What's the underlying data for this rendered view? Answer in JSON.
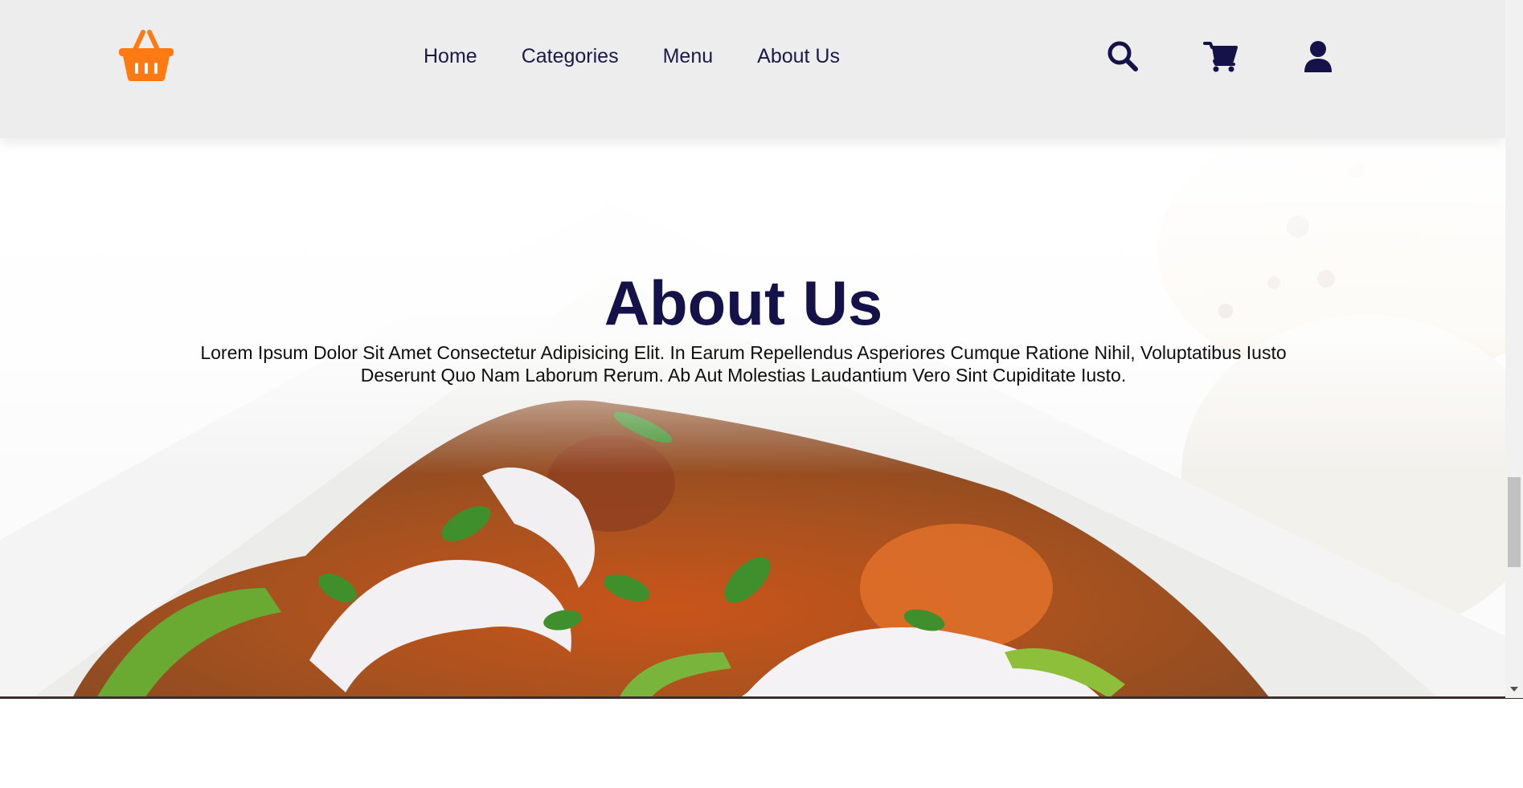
{
  "header": {
    "logo_icon": "shopping-basket-icon",
    "nav": [
      {
        "label": "Home"
      },
      {
        "label": "Categories"
      },
      {
        "label": "Menu"
      },
      {
        "label": "About Us"
      }
    ],
    "icons": [
      "search-icon",
      "cart-icon",
      "user-icon"
    ]
  },
  "hero": {
    "title": "About Us",
    "text": "Lorem Ipsum Dolor Sit Amet Consectetur Adipisicing Elit. In Earum Repellendus Asperiores Cumque Ratione Nihil, Voluptatibus Iusto Deserunt Quo Nam Laborum Rerum. Ab Aut Molestias Laudantium Vero Sint Cupiditate Iusto."
  },
  "colors": {
    "accent": "#ff7a12",
    "nav_text": "#1b1a47",
    "title": "#15124a",
    "header_bg": "#ededee"
  }
}
